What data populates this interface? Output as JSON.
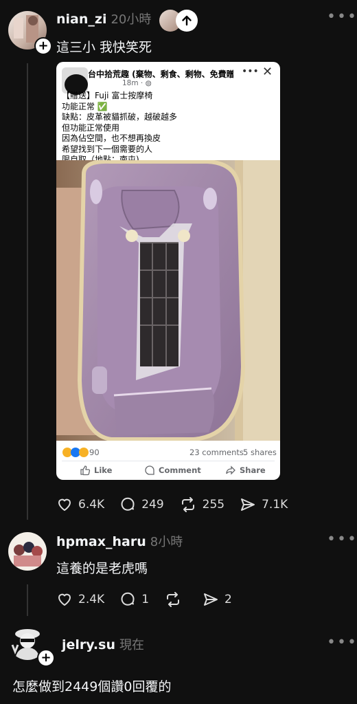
{
  "post1": {
    "username": "nian_zi",
    "time": "20小時",
    "text": "這三小 我快笑死",
    "embed": {
      "group_name": "台中拾荒趣 (棄物、剩食、剩物、免費贈...",
      "post_time": "18m",
      "lines": [
        "【贈送】Fuji 富士按摩椅",
        "功能正常 ✅",
        "缺點：皮革被貓抓破，越破越多",
        "但功能正常使用",
        "因為佔空間，也不想再換皮",
        "希望找到下一個需要的人",
        "限自取（地點：南屯)"
      ],
      "reactions_count": "90",
      "comments": "23 comments",
      "shares": "5 shares",
      "like_label": "Like",
      "comment_label": "Comment",
      "share_label": "Share"
    },
    "likes": "6.4K",
    "replies": "249",
    "reposts": "255",
    "shares": "7.1K"
  },
  "post2": {
    "username": "hpmax_haru",
    "time": "8小時",
    "text": "這養的是老虎嗎",
    "likes": "2.4K",
    "replies": "1",
    "shares": "2"
  },
  "post3": {
    "username": "jelry.su",
    "time": "現在",
    "text": "怎麼做到2449個讚0回覆的"
  },
  "colors": {
    "background": "#101010",
    "text": "#f3f5f7",
    "muted": "#777777"
  }
}
